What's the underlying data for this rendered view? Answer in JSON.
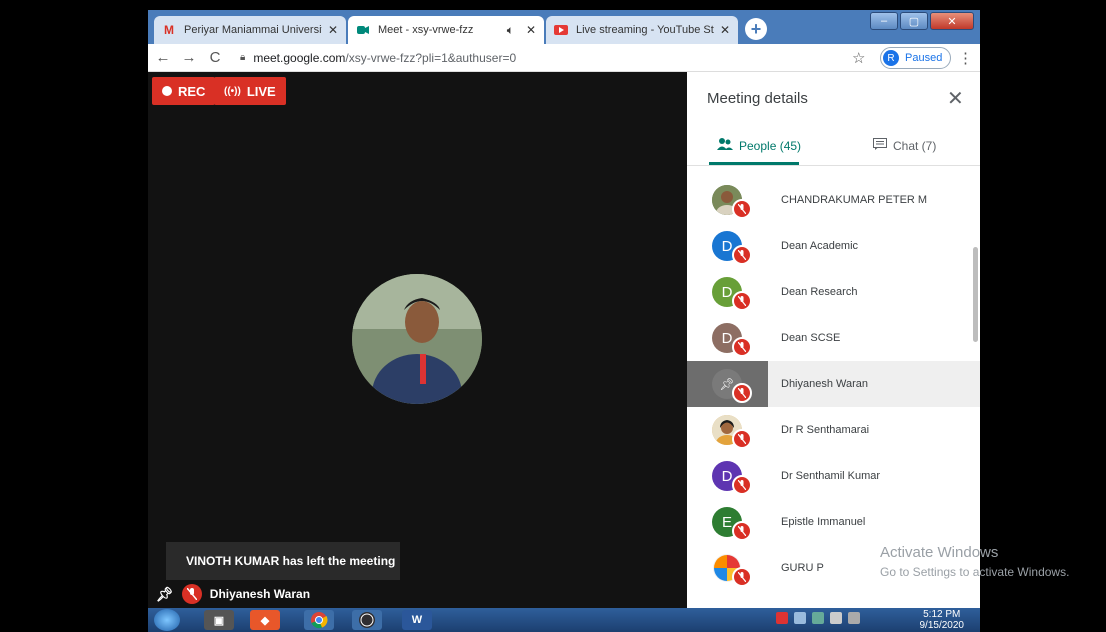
{
  "browser": {
    "tabs": [
      {
        "title": "Periyar Maniammai University M",
        "icon": "gmail-icon"
      },
      {
        "title": "Meet - xsy-vrwe-fzz",
        "icon": "meet-icon"
      },
      {
        "title": "Live streaming - YouTube Studio",
        "icon": "youtube-icon"
      }
    ],
    "url_host": "meet.google.com",
    "url_path": "/xsy-vrwe-fzz?pli=1&authuser=0",
    "profile_initial": "R",
    "profile_status": "Paused"
  },
  "meet": {
    "rec_label": "REC",
    "live_label": "LIVE",
    "toast": "VINOTH KUMAR has left the meeting",
    "self_name": "Dhiyanesh Waran"
  },
  "panel": {
    "title": "Meeting details",
    "people_tab": "People (45)",
    "chat_tab": "Chat (7)",
    "people": [
      {
        "name": "CHANDRAKUMAR PETER M",
        "initial": "",
        "color": "#6b8f5a",
        "photo": true
      },
      {
        "name": "Dean Academic",
        "initial": "D",
        "color": "#1976d2"
      },
      {
        "name": "Dean Research",
        "initial": "D",
        "color": "#689f38"
      },
      {
        "name": "Dean SCSE",
        "initial": "D",
        "color": "#8d6e63"
      },
      {
        "name": "Dhiyanesh Waran",
        "initial": "",
        "color": "#7a7a7a",
        "selected": true
      },
      {
        "name": "Dr R Senthamarai",
        "initial": "",
        "color": "#e8b86a",
        "photo": true
      },
      {
        "name": "Dr Senthamil Kumar",
        "initial": "D",
        "color": "#5e35b1"
      },
      {
        "name": "Epistle Immanuel",
        "initial": "E",
        "color": "#2e7d32"
      },
      {
        "name": "GURU P",
        "initial": "",
        "color": "#e57373",
        "photo": true
      }
    ]
  },
  "watermark": {
    "line1": "Activate Windows",
    "line2": "Go to Settings to activate Windows."
  },
  "taskbar": {
    "time": "5:12 PM",
    "date": "9/15/2020"
  }
}
